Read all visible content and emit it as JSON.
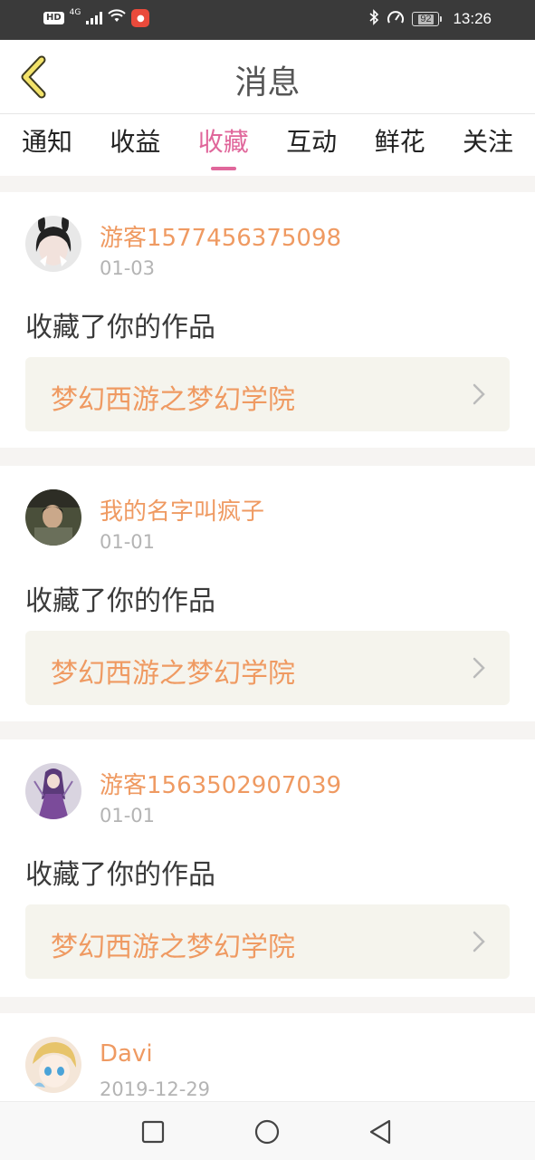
{
  "status_bar": {
    "hd": "HD",
    "network": "4G",
    "battery": "92",
    "time": "13:26",
    "icons": [
      "signal-icon",
      "wifi-icon",
      "app-notification-icon",
      "bluetooth-icon",
      "speedometer-icon",
      "battery-icon"
    ]
  },
  "header": {
    "title": "消息",
    "back_icon": "chevron-left-icon"
  },
  "tabs": [
    {
      "label": "通知",
      "active": false
    },
    {
      "label": "收益",
      "active": false
    },
    {
      "label": "收藏",
      "active": true
    },
    {
      "label": "互动",
      "active": false
    },
    {
      "label": "鲜花",
      "active": false
    },
    {
      "label": "关注",
      "active": false
    }
  ],
  "messages": [
    {
      "username": "游客1577456375098",
      "date": "01-03",
      "action": "收藏了你的作品",
      "work": "梦幻西游之梦幻学院"
    },
    {
      "username": "我的名字叫疯子",
      "date": "01-01",
      "action": "收藏了你的作品",
      "work": "梦幻西游之梦幻学院"
    },
    {
      "username": "游客1563502907039",
      "date": "01-01",
      "action": "收藏了你的作品",
      "work": "梦幻西游之梦幻学院"
    },
    {
      "username": "Davi",
      "date": "2019-12-29",
      "action": "",
      "work": ""
    }
  ],
  "nav_bar": {
    "icons": [
      "recents-square-icon",
      "home-circle-icon",
      "back-triangle-icon"
    ]
  },
  "colors": {
    "accent_pink": "#e0679b",
    "username_orange": "#ef9a62",
    "work_bg": "#f5f4ed"
  }
}
